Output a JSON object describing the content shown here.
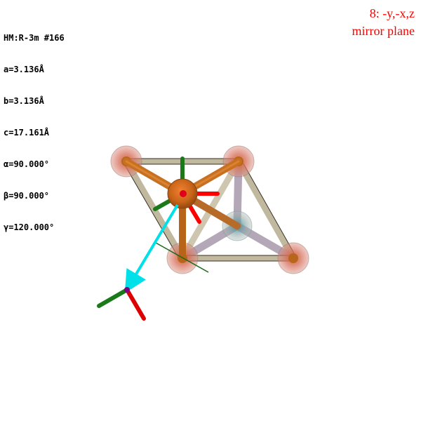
{
  "cell_info": {
    "space_group": "HM:R-3m #166",
    "a": "a=3.136Å",
    "b": "b=3.136Å",
    "c": "c=17.161Å",
    "alpha": "α=90.000°",
    "beta": "β=90.000°",
    "gamma": "γ=120.000°"
  },
  "symmetry_operation": {
    "label": "8: -y,-x,z",
    "description": "mirror plane"
  },
  "colors": {
    "text": "#000000",
    "symop_text": "#ff0000",
    "unit_cell_frame": "#b5ab8e",
    "atom_outer": "#e0796a",
    "atom_center": "#c46a1a",
    "axis_x": "#ff0000",
    "axis_y": "#008000",
    "axis_z": "#a0522d",
    "symmetry_arrow": "#00e0e8",
    "origin_marker": "#800080"
  }
}
